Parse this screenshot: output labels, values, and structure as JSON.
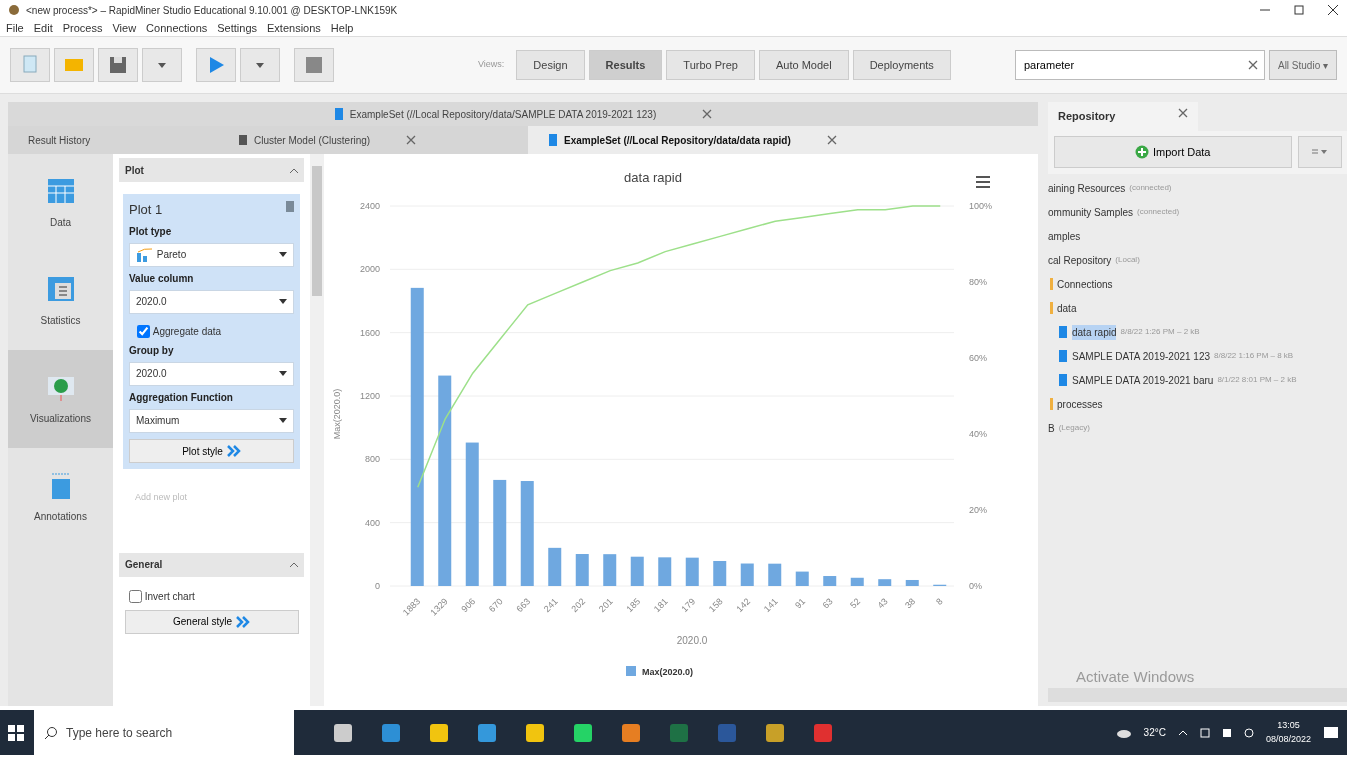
{
  "window": {
    "title": "<new process*> – RapidMiner Studio Educational 9.10.001 @ DESKTOP-LNK159K"
  },
  "menu": [
    "File",
    "Edit",
    "Process",
    "View",
    "Connections",
    "Settings",
    "Extensions",
    "Help"
  ],
  "views_label": "Views:",
  "views": [
    {
      "label": "Design",
      "selected": false
    },
    {
      "label": "Results",
      "selected": true
    },
    {
      "label": "Turbo Prep",
      "selected": false
    },
    {
      "label": "Auto Model",
      "selected": false
    },
    {
      "label": "Deployments",
      "selected": false
    }
  ],
  "search": {
    "value": "parameter",
    "scope": "All Studio ▾"
  },
  "top_result_tabs": [
    {
      "label": "ExampleSet (//Local Repository/data/SAMPLE DATA 2019-2021 123)",
      "selected": false
    }
  ],
  "result_tabs": [
    {
      "label": "Result History",
      "kind": "history",
      "selected": false
    },
    {
      "label": "Cluster Model (Clustering)",
      "kind": "model",
      "selected": false
    },
    {
      "label": "ExampleSet (//Local Repository/data/data rapid)",
      "kind": "exampleset",
      "selected": true
    }
  ],
  "side_nav": [
    {
      "label": "Data",
      "kind": "data",
      "selected": false
    },
    {
      "label": "Statistics",
      "kind": "statistics",
      "selected": false
    },
    {
      "label": "Visualizations",
      "kind": "visualizations",
      "selected": true
    },
    {
      "label": "Annotations",
      "kind": "annotations",
      "selected": false
    }
  ],
  "plot_panel": {
    "header": "Plot",
    "plot_title": "Plot 1",
    "plot_type_label": "Plot type",
    "plot_type": "Pareto",
    "value_column_label": "Value column",
    "value_column": "2020.0",
    "aggregate": {
      "label": "Aggregate data",
      "checked": true
    },
    "group_by_label": "Group by",
    "group_by": "2020.0",
    "agg_fn_label": "Aggregation Function",
    "agg_fn": "Maximum",
    "plot_style": "Plot style",
    "add_plot": "Add new plot"
  },
  "general_panel": {
    "header": "General",
    "invert": {
      "label": "Invert chart",
      "checked": false
    },
    "style": "General style"
  },
  "chart": {
    "chart_data": {
      "type": "bar",
      "title": "data rapid",
      "xlabel": "2020.0",
      "ylabel": "Max(2020.0)",
      "categories": [
        "1883",
        "1329",
        "906",
        "670",
        "663",
        "241",
        "202",
        "201",
        "185",
        "181",
        "179",
        "158",
        "142",
        "141",
        "91",
        "63",
        "52",
        "43",
        "38",
        "8"
      ],
      "series": [
        {
          "name": "Max(2020.0)",
          "color": "#6fa8e0",
          "values": [
            1883,
            1329,
            906,
            670,
            663,
            241,
            202,
            201,
            185,
            181,
            179,
            158,
            142,
            141,
            91,
            63,
            52,
            43,
            38,
            8
          ]
        },
        {
          "color": "#9de08a",
          "type": "line",
          "axis": "y2",
          "values": [
            26,
            44,
            56,
            65,
            74,
            77,
            80,
            83,
            85,
            88,
            90,
            92,
            94,
            96,
            97,
            98,
            99,
            99,
            100,
            100
          ]
        }
      ],
      "ylim": [
        0,
        2400
      ],
      "y2lim": [
        0,
        100
      ],
      "grid": true,
      "yticks": [
        0,
        400,
        800,
        1200,
        1600,
        2000,
        2400
      ],
      "y2ticks": [
        {
          "value": 0,
          "label": "0%"
        },
        {
          "value": 20,
          "label": "20%"
        },
        {
          "value": 40,
          "label": "40%"
        },
        {
          "value": 60,
          "label": "60%"
        },
        {
          "value": 80,
          "label": "80%"
        },
        {
          "value": 100,
          "label": "100%"
        }
      ]
    }
  },
  "repository": {
    "title": "Repository",
    "import": "Import Data",
    "tree": [
      {
        "label": "aining Resources",
        "meta": "(connected)",
        "kind": "root",
        "selected": false
      },
      {
        "label": "ommunity Samples",
        "meta": "(connected)",
        "kind": "root",
        "selected": false
      },
      {
        "label": "amples",
        "kind": "root",
        "selected": false
      },
      {
        "label": "cal Repository",
        "meta": "(Local)",
        "kind": "root",
        "selected": false,
        "children": [
          {
            "label": "Connections",
            "kind": "folder",
            "selected": false
          },
          {
            "label": "data",
            "kind": "folder",
            "selected": false,
            "children": [
              {
                "label": "data rapid",
                "meta": "8/8/22 1:26 PM – 2 kB",
                "kind": "data",
                "selected": true
              },
              {
                "label": "SAMPLE DATA 2019-2021 123",
                "meta": "8/8/22 1:16 PM – 8 kB",
                "kind": "data",
                "selected": false
              },
              {
                "label": "SAMPLE DATA 2019-2021 baru",
                "meta": "8/1/22 8:01 PM – 2 kB",
                "kind": "data",
                "selected": false
              }
            ]
          },
          {
            "label": "processes",
            "kind": "folder",
            "selected": false
          }
        ]
      },
      {
        "label": "B",
        "meta": "(Legacy)",
        "kind": "root",
        "selected": false
      }
    ],
    "overlay": "Activate Windows"
  },
  "taskbar": {
    "search": "Type here to search",
    "weather": "32°C",
    "time": "13:05",
    "date": "08/08/2022"
  }
}
